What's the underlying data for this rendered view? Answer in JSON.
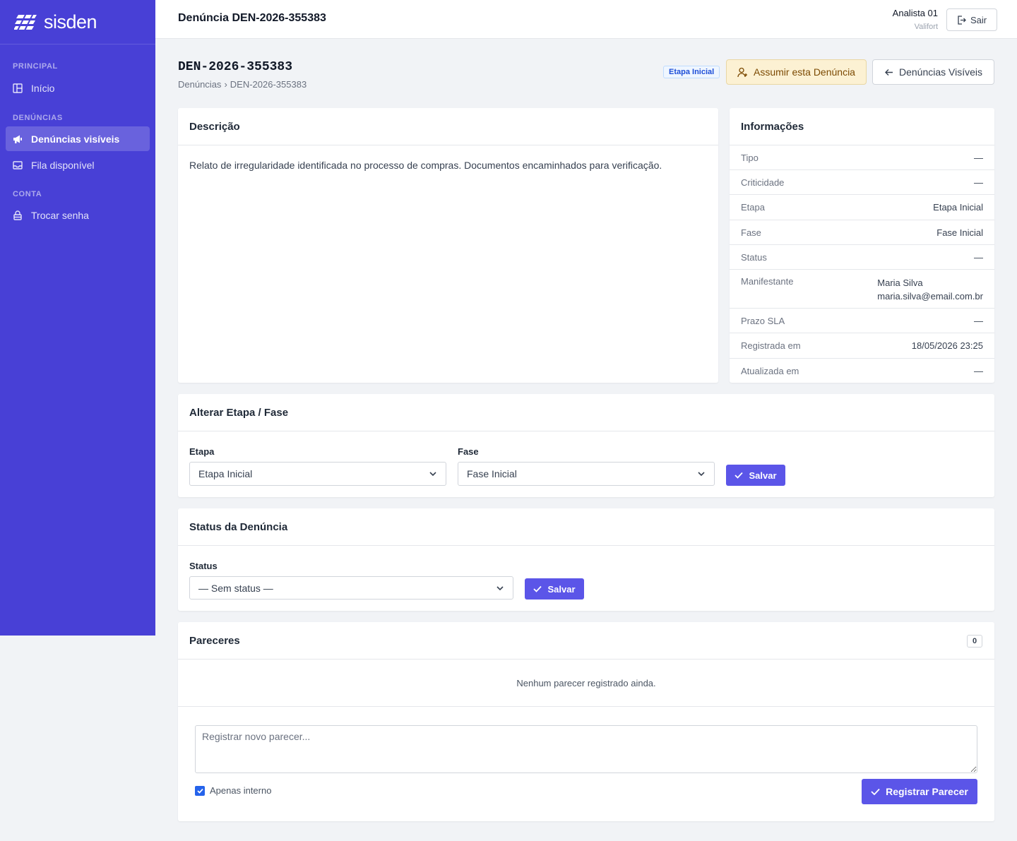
{
  "sidebar": {
    "logo": "sisden",
    "sections": {
      "principal": "PRINCIPAL",
      "denuncias": "DENÚNCIAS",
      "conta": "CONTA"
    },
    "items": {
      "inicio": "Início",
      "denuncias_visiveis": "Denúncias visíveis",
      "fila_disponivel": "Fila disponível",
      "trocar_senha": "Trocar senha"
    }
  },
  "topbar": {
    "title": "Denúncia DEN-2026-355383",
    "user_name": "Analista 01",
    "user_org": "Valifort",
    "logout": "Sair"
  },
  "header": {
    "id": "DEN-2026-355383",
    "breadcrumb": [
      "Denúncias",
      "DEN-2026-355383"
    ],
    "badge": "Etapa Inicial",
    "assume": "Assumir esta Denúncia",
    "back": "Denúncias Visíveis"
  },
  "descricao": {
    "title": "Descrição",
    "text": "Relato de irregularidade identificada no processo de compras. Documentos encaminhados para verificação."
  },
  "info": {
    "title": "Informações",
    "rows": [
      {
        "label": "Tipo",
        "value": "—"
      },
      {
        "label": "Criticidade",
        "value": "—"
      },
      {
        "label": "Etapa",
        "value": "Etapa Inicial"
      },
      {
        "label": "Fase",
        "value": "Fase Inicial"
      },
      {
        "label": "Status",
        "value": "—"
      },
      {
        "label": "Manifestante",
        "name": "Maria Silva",
        "email": "maria.silva@email.com.br"
      },
      {
        "label": "Prazo SLA",
        "value": "—"
      },
      {
        "label": "Registrada em",
        "value": "18/05/2026 23:25"
      },
      {
        "label": "Atualizada em",
        "value": "—"
      }
    ]
  },
  "alterar": {
    "title": "Alterar Etapa / Fase",
    "etapa_label": "Etapa",
    "etapa_value": "Etapa Inicial",
    "fase_label": "Fase",
    "fase_value": "Fase Inicial",
    "save": "Salvar"
  },
  "status": {
    "title": "Status da Denúncia",
    "label": "Status",
    "value": "— Sem status —",
    "save": "Salvar"
  },
  "pareceres": {
    "title": "Pareceres",
    "count": "0",
    "empty": "Nenhum parecer registrado ainda.",
    "placeholder": "Registrar novo parecer...",
    "internal_label": "Apenas interno",
    "submit": "Registrar Parecer"
  },
  "colors": {
    "sidebar": "#4840d6",
    "primary": "#5b55e8",
    "badge": "#1d4ed8",
    "assume_bg": "#fcf1d3"
  }
}
